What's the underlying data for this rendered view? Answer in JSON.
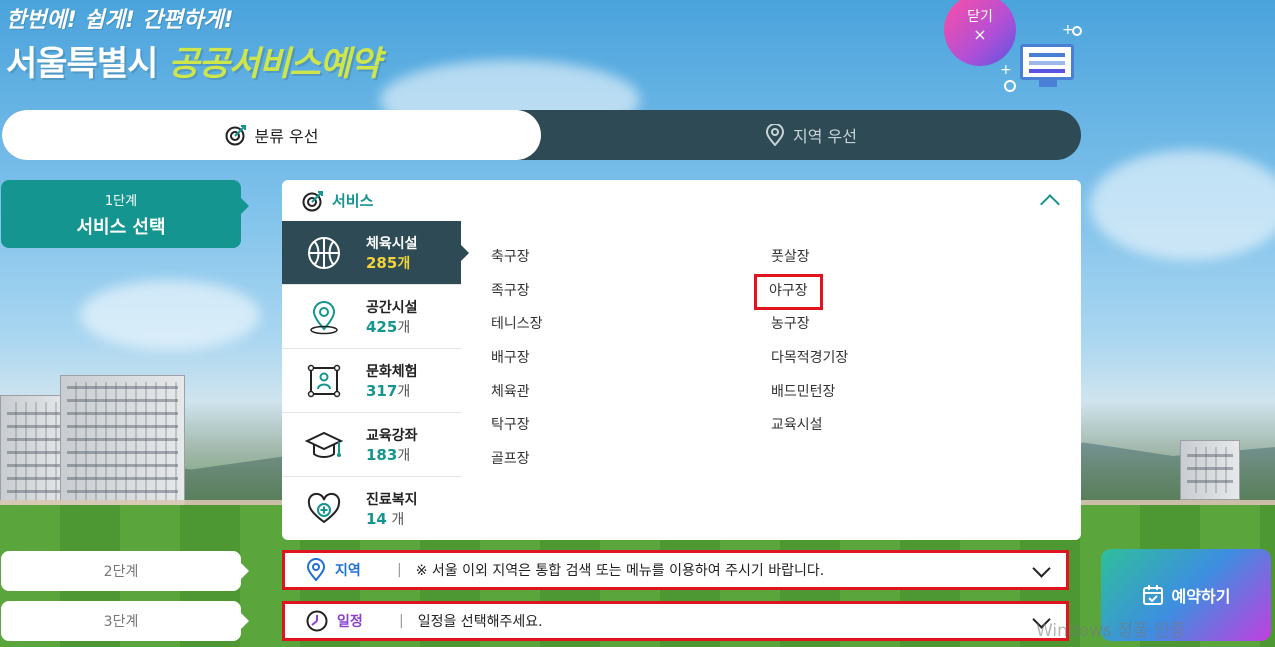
{
  "header": {
    "tagline": "한번에! 쉽게! 간편하게!",
    "brand_main": "서울특별시",
    "brand_accent": "공공서비스예약",
    "close_label": "닫기",
    "close_symbol": "×"
  },
  "tabs": [
    {
      "label": "분류 우선",
      "icon": "target-icon",
      "active": true
    },
    {
      "label": "지역 우선",
      "icon": "location-pin-icon",
      "active": false
    }
  ],
  "steps": {
    "step1": {
      "num": "1단계",
      "title": "서비스 선택"
    },
    "step2": {
      "num": "2단계"
    },
    "step3": {
      "num": "3단계"
    }
  },
  "service_panel": {
    "title": "서비스",
    "categories": [
      {
        "name": "체육시설",
        "count": "285",
        "unit": "개",
        "icon": "basketball-icon",
        "selected": true
      },
      {
        "name": "공간시설",
        "count": "425",
        "unit": "개",
        "icon": "map-pin-icon",
        "selected": false
      },
      {
        "name": "문화체험",
        "count": "317",
        "unit": "개",
        "icon": "person-frame-icon",
        "selected": false
      },
      {
        "name": "교육강좌",
        "count": "183",
        "unit": "개",
        "icon": "graduation-cap-icon",
        "selected": false
      },
      {
        "name": "진료복지",
        "count": "14",
        "unit": " 개",
        "icon": "heart-plus-icon",
        "selected": false
      }
    ],
    "facilities_left": [
      "축구장",
      "족구장",
      "테니스장",
      "배구장",
      "체육관",
      "탁구장",
      "골프장"
    ],
    "facilities_right": [
      "풋살장",
      "야구장",
      "농구장",
      "다목적경기장",
      "배드민턴장",
      "교육시설"
    ],
    "highlighted_facility": "야구장"
  },
  "region_row": {
    "label": "지역",
    "separator": "|",
    "text": "※ 서울 이외 지역은 통합 검색 또는 메뉴를 이용하여 주시기 바랍니다."
  },
  "schedule_row": {
    "label": "일정",
    "separator": "|",
    "text": "일정을 선택해주세요."
  },
  "reserve_button": {
    "label": "예약하기",
    "icon": "calendar-check-icon"
  },
  "watermark": "Windows 정품 인증",
  "colors": {
    "teal": "#14958f",
    "dark": "#2d4a55",
    "highlight_red": "#e0141e",
    "count_yellow": "#f3d43c",
    "schedule_purple": "#8a3fd1",
    "region_blue": "#1f6fd6"
  }
}
